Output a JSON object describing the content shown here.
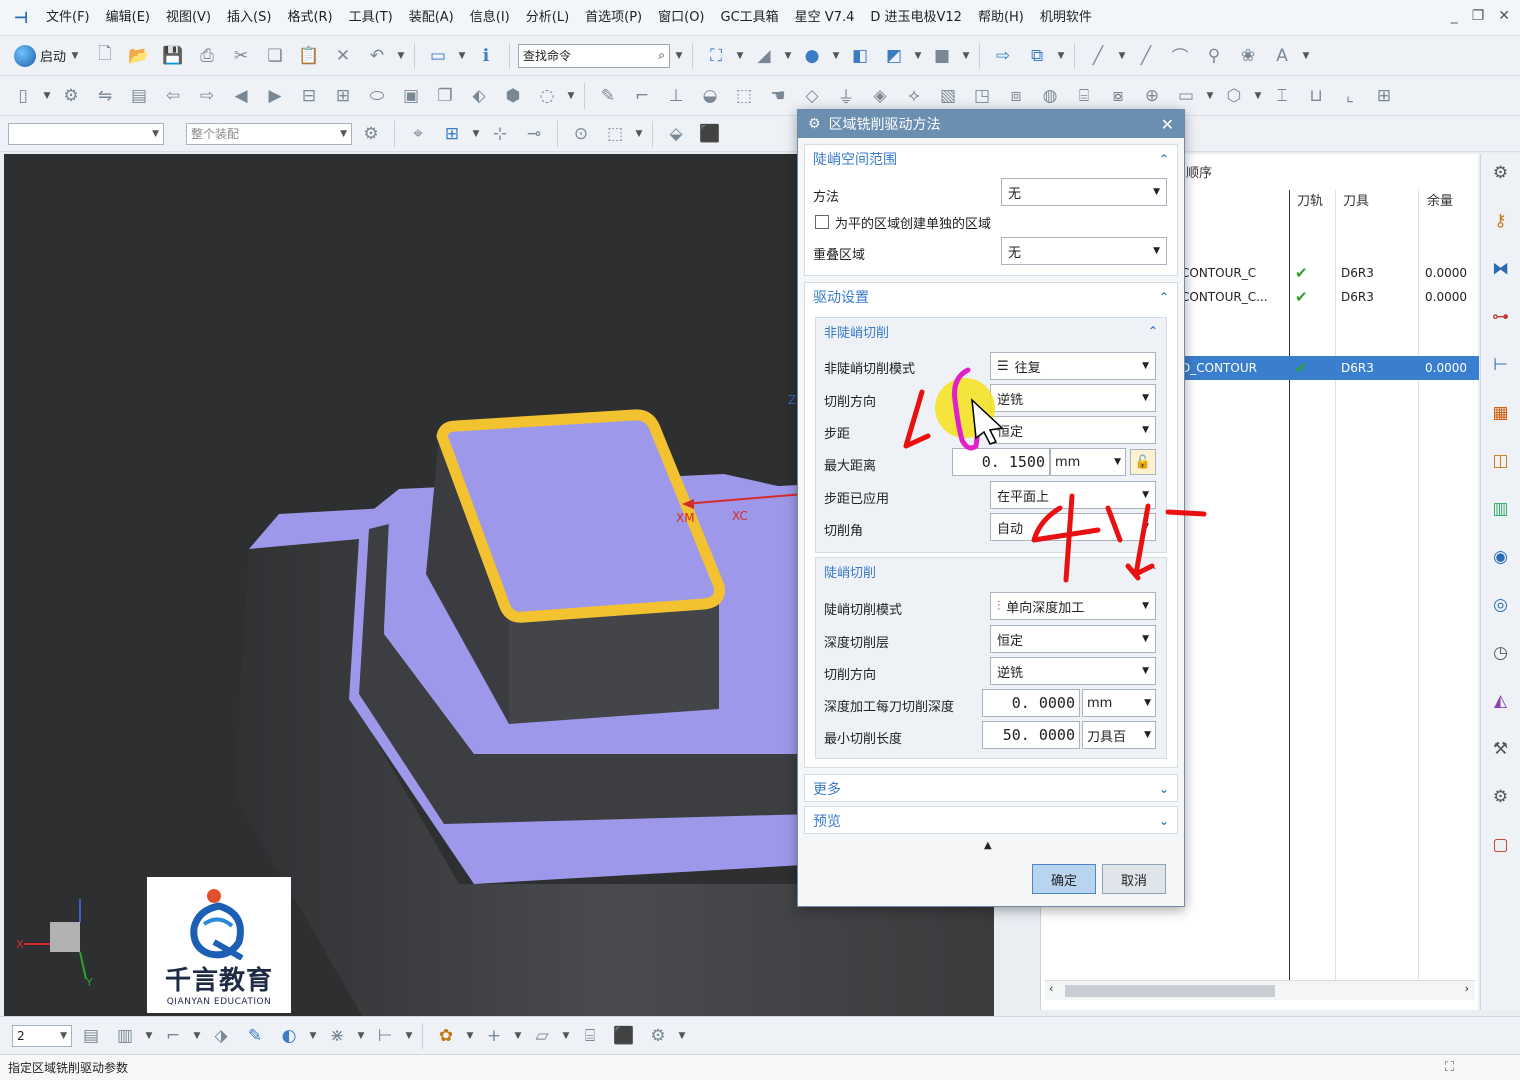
{
  "menu": {
    "items": [
      "文件(F)",
      "编辑(E)",
      "视图(V)",
      "插入(S)",
      "格式(R)",
      "工具(T)",
      "装配(A)",
      "信息(I)",
      "分析(L)",
      "首选项(P)",
      "窗口(O)",
      "GC工具箱",
      "星空 V7.4",
      "D 进玉电极V12",
      "帮助(H)",
      "机明软件"
    ]
  },
  "toolbar": {
    "start_label": "启动",
    "search_placeholder": "查找命令",
    "assembly_filter": "整个装配"
  },
  "dialog": {
    "title": "区域铣削驱动方法",
    "steep_section": {
      "title": "陡峭空间范围",
      "method_label": "方法",
      "method_value": "无",
      "separate_regions_label": "为平的区域创建单独的区域",
      "overlap_label": "重叠区域",
      "overlap_value": "无"
    },
    "drive_section": {
      "title": "驱动设置",
      "non_steep": {
        "title": "非陡峭切削",
        "cut_pattern_label": "非陡峭切削模式",
        "cut_pattern_value": "往复",
        "cut_direction_label": "切削方向",
        "cut_direction_value": "逆铣",
        "stepover_label": "步距",
        "stepover_value": "恒定",
        "max_distance_label": "最大距离",
        "max_distance_value": "0. 1500",
        "max_distance_unit": "mm",
        "stepover_applied_label": "步距已应用",
        "stepover_applied_value": "在平面上",
        "cut_angle_label": "切削角",
        "cut_angle_value": "自动"
      },
      "steep": {
        "title": "陡峭切削",
        "cut_pattern_label": "陡峭切削模式",
        "cut_pattern_value": "单向深度加工",
        "depth_levels_label": "深度切削层",
        "depth_levels_value": "恒定",
        "cut_direction_label": "切削方向",
        "cut_direction_value": "逆铣",
        "depth_per_cut_label": "深度加工每刀切削深度",
        "depth_per_cut_value": "0. 0000",
        "depth_per_cut_unit": "mm",
        "min_cut_length_label": "最小切削长度",
        "min_cut_length_value": "50. 0000",
        "min_cut_length_unit": "刀具百"
      }
    },
    "more_title": "更多",
    "preview_title": "预览",
    "ok_label": "确定",
    "cancel_label": "取消"
  },
  "navigator": {
    "title_fragment": "顺序",
    "columns": [
      "刀轨",
      "刀具",
      "余量"
    ],
    "rows": [
      {
        "name": "CONTOUR_C",
        "tool": "D6R3",
        "stock": "0.0000",
        "selected": false
      },
      {
        "name": "CONTOUR_C...",
        "tool": "D6R3",
        "stock": "0.0000",
        "selected": false
      },
      {
        "name": "D_CONTOUR",
        "tool": "D6R3",
        "stock": "0.0000",
        "selected": true
      }
    ]
  },
  "viewport": {
    "axis_labels": [
      "XM",
      "XC",
      "Z",
      "X",
      "Y"
    ],
    "logo_text": "千言教育",
    "logo_subtext": "QIANYAN EDUCATION"
  },
  "bottom": {
    "layer_value": "2"
  },
  "status": {
    "text": "指定区域铣削驱动参数"
  },
  "colors": {
    "face": "#9d98ea",
    "side": "#3f4043",
    "highlight": "#f2c230",
    "accent": "#3a7fcf",
    "title_bar": "#6b8fb0"
  }
}
